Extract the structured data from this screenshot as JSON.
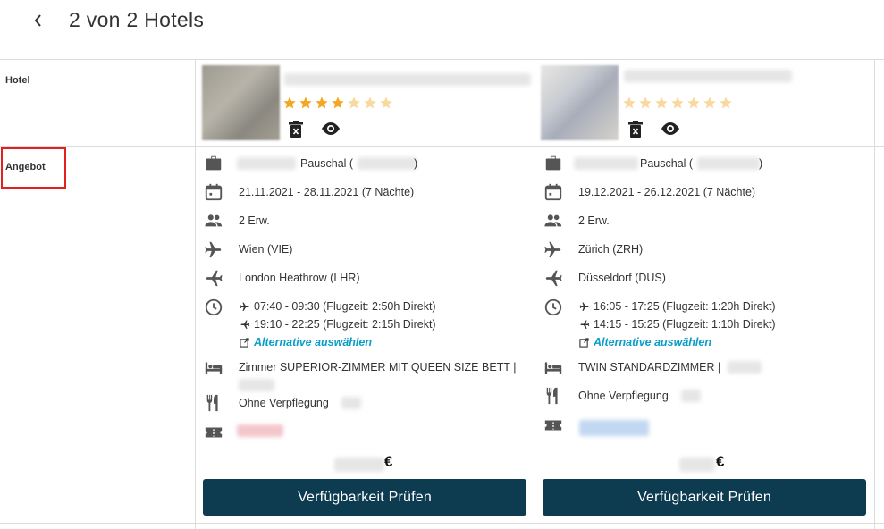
{
  "header": {
    "title": "2 von 2 Hotels"
  },
  "rows": {
    "hotel_label": "Hotel",
    "offer_label": "Angebot"
  },
  "hotels": [
    {
      "stars_filled": 4,
      "stars_total": 7,
      "package": "Pauschal (",
      "package_close": ")",
      "dates": "21.11.2021 - 28.11.2021 (7 Nächte)",
      "guests": "2 Erw.",
      "departure": "Wien (VIE)",
      "arrival": "London Heathrow (LHR)",
      "outbound": "07:40 - 09:30 (Flugzeit: 2:50h Direkt)",
      "inbound": "19:10 - 22:25 (Flugzeit: 2:15h Direkt)",
      "alternative": "Alternative auswählen",
      "room": "Zimmer SUPERIOR-ZIMMER MIT QUEEN SIZE BETT |",
      "board": "Ohne Verpflegung",
      "price_currency": "€",
      "cta": "Verfügbarkeit Prüfen"
    },
    {
      "stars_filled": 0,
      "stars_total": 7,
      "package": "Pauschal (",
      "package_close": ")",
      "dates": "19.12.2021 - 26.12.2021 (7 Nächte)",
      "guests": "2 Erw.",
      "departure": "Zürich (ZRH)",
      "arrival": "Düsseldorf (DUS)",
      "outbound": "16:05 - 17:25 (Flugzeit: 1:20h Direkt)",
      "inbound": "14:15 - 15:25 (Flugzeit: 1:10h Direkt)",
      "alternative": "Alternative auswählen",
      "room": "TWIN STANDARDZIMMER |",
      "board": "Ohne Verpflegung",
      "price_currency": "€",
      "cta": "Verfügbarkeit Prüfen"
    }
  ],
  "colors": {
    "star_filled": "#f5a623",
    "star_empty": "#f8d9a0",
    "cta_bg": "#0d3b50",
    "link": "#0a9ec7",
    "highlight": "#e0211d"
  }
}
